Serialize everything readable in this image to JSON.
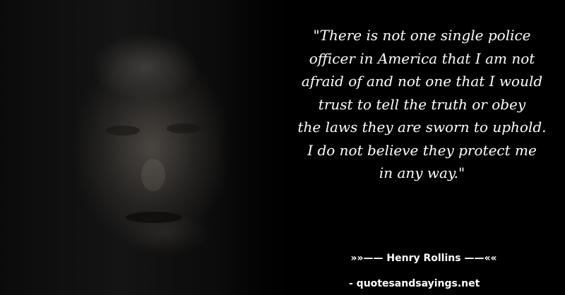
{
  "quote": {
    "lines": [
      "\"There is not one single police",
      "officer in America that I am not",
      "afraid of and not one that I would",
      "trust to tell the truth or obey",
      "the laws they are sworn to uphold.",
      "I do not believe they protect me",
      "in any way.\""
    ]
  },
  "author": {
    "text": "»»—— Henry Rollins ——««"
  },
  "source": {
    "text": "- quotesandsayings.net"
  },
  "colors": {
    "background": "#000000",
    "text": "#ffffff"
  }
}
